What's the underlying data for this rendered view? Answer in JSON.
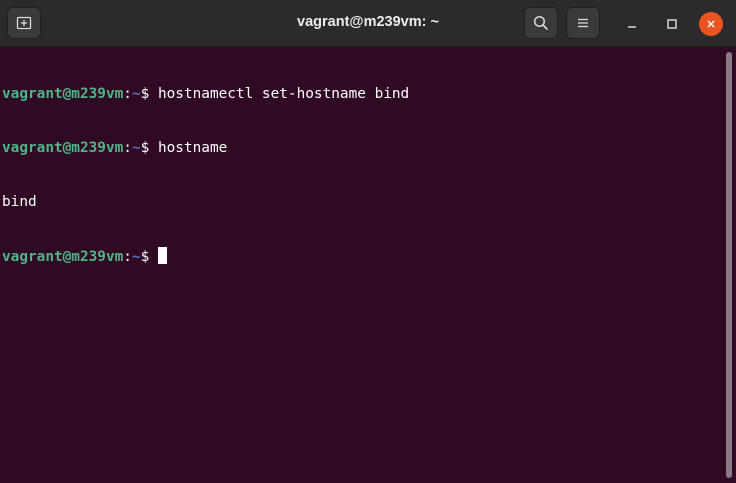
{
  "window": {
    "title": "vagrant@m239vm: ~"
  },
  "titlebar": {
    "new_tab_icon": "new-tab-icon",
    "search_icon": "search-icon",
    "menu_icon": "hamburger-menu-icon",
    "minimize_icon": "minimize-icon",
    "maximize_icon": "maximize-icon",
    "close_icon": "close-icon",
    "close_color": "#e95420"
  },
  "terminal": {
    "background": "#300a24",
    "prompt_user_color": "#4eb589",
    "prompt_path_color": "#4f6fbf",
    "lines": [
      {
        "user": "vagrant@m239vm",
        "sep": ":",
        "path": "~",
        "symbol": "$ ",
        "command": "hostnamectl set-hostname bind"
      },
      {
        "user": "vagrant@m239vm",
        "sep": ":",
        "path": "~",
        "symbol": "$ ",
        "command": "hostname"
      },
      {
        "output": "bind"
      },
      {
        "user": "vagrant@m239vm",
        "sep": ":",
        "path": "~",
        "symbol": "$ ",
        "command": ""
      }
    ]
  }
}
